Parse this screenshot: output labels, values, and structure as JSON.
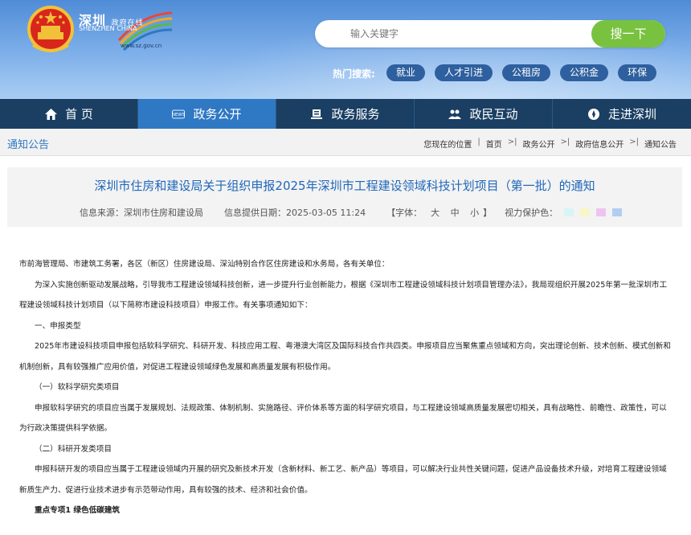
{
  "header": {
    "logo_cn": "深圳",
    "logo_cn_small": "政府在线",
    "logo_en": "SHENZHEN CHINA",
    "logo_url": "www.sz.gov.cn",
    "search": {
      "placeholder": "输入关键字",
      "button_label": "搜一下"
    },
    "hot_label": "热门搜索:",
    "hot_tags": [
      "就业",
      "人才引进",
      "公租房",
      "公积金",
      "环保"
    ]
  },
  "nav": {
    "items": [
      {
        "label": "首 页",
        "icon": "home-icon"
      },
      {
        "label": "政务公开",
        "icon": "news-icon"
      },
      {
        "label": "政务服务",
        "icon": "service-icon"
      },
      {
        "label": "政民互动",
        "icon": "people-icon"
      },
      {
        "label": "走进深圳",
        "icon": "compass-icon"
      }
    ],
    "active_index": 1
  },
  "section_title": "通知公告",
  "breadcrumb": {
    "location_label": "您现在的位置",
    "items": [
      "首页",
      "政务公开",
      "政府信息公开",
      "通知公告"
    ]
  },
  "article": {
    "title": "深圳市住房和建设局关于组织申报2025年深圳市工程建设领域科技计划项目（第一批）的通知",
    "source": "信息来源：深圳市住房和建设局",
    "date": "信息提供日期：2025-03-05 11:24",
    "font_label": "【字体：",
    "font_sizes": [
      "大",
      "中",
      "小"
    ],
    "font_end": "】",
    "vision_label": "视力保护色：",
    "vision_colors": [
      "#d9f4f6",
      "#f7f6c7",
      "#efc3f1",
      "#b2cdf2"
    ],
    "paragraphs": [
      "市前海管理局、市建筑工务署，各区（新区）住房建设局、深汕特别合作区住房建设和水务局，各有关单位：",
      "为深入实施创新驱动发展战略，引导我市工程建设领域科技创新，进一步提升行业创新能力，根据《深圳市工程建设领域科技计划项目管理办法》，我局现组织开展2025年第一批深圳市工程建设领域科技计划项目（以下简称市建设科技项目）申报工作。有关事项通知如下：",
      "一、申报类型",
      "2025年市建设科技项目申报包括软科学研究、科研开发、科技应用工程、粤港澳大湾区及国际科技合作共四类。申报项目应当聚焦重点领域和方向，突出理论创新、技术创新、模式创新和机制创新，具有较强推广应用价值，对促进工程建设领域绿色发展和高质量发展有积极作用。",
      "（一）软科学研究类项目",
      "申报软科学研究的项目应当属于发展规划、法规政策、体制机制、实施路径、评价体系等方面的科学研究项目，与工程建设领域高质量发展密切相关，具有战略性、前瞻性、政策性，可以为行政决策提供科学依据。",
      "（二）科研开发类项目",
      "申报科研开发的项目应当属于工程建设领域内开展的研究及新技术开发（含新材料、新工艺、新产品）等项目，可以解决行业共性关键问题，促进产品设备技术升级，对培育工程建设领域新质生产力、促进行业技术进步有示范带动作用，具有较强的技术、经济和社会价值。",
      "重点专项1 绿色低碳建筑"
    ]
  }
}
